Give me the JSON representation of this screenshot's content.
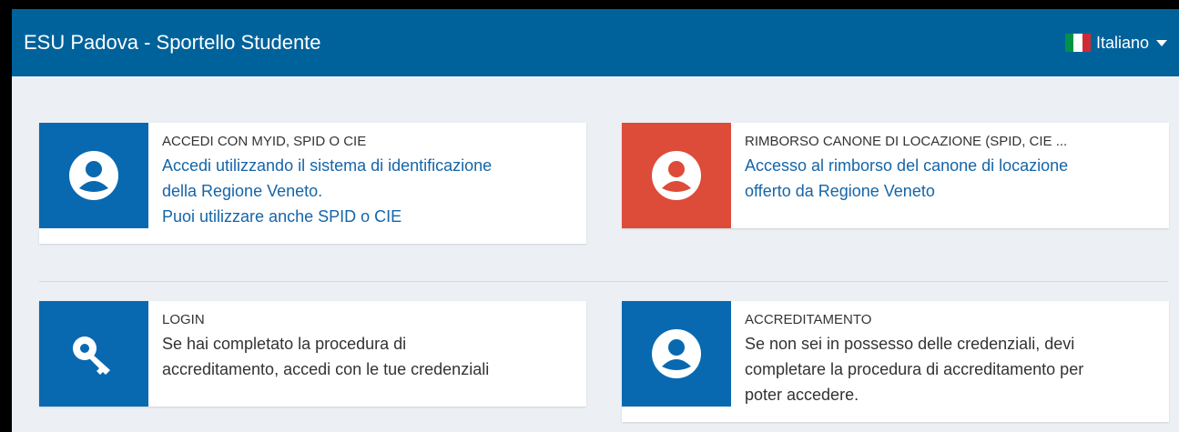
{
  "header": {
    "title": "ESU Padova - Sportello Studente",
    "language": "Italiano"
  },
  "colors": {
    "navbar": "#00629b",
    "card_blue": "#0869b1",
    "card_red": "#dd4b39",
    "link": "#1565a8"
  },
  "cards": [
    {
      "title": "ACCEDI CON MYID, SPID O CIE",
      "line1": "Accedi utilizzando il sistema di identificazione",
      "line2": "della Regione Veneto.",
      "line3": "Puoi utilizzare anche SPID o CIE",
      "icon": "user-circle-icon"
    },
    {
      "title": "RIMBORSO CANONE DI LOCAZIONE (SPID, CIE ...",
      "line1": "Accesso al rimborso del canone di locazione",
      "line2": "offerto da Regione Veneto",
      "icon": "user-circle-icon"
    },
    {
      "title": "LOGIN",
      "line1": "Se hai completato la procedura di",
      "line2": "accreditamento, accedi con le tue credenziali",
      "icon": "key-icon"
    },
    {
      "title": "ACCREDITAMENTO",
      "line1": "Se non sei in possesso delle credenziali, devi",
      "line2": "completare la procedura di accreditamento per",
      "line3": "poter accedere.",
      "icon": "user-circle-icon"
    }
  ]
}
